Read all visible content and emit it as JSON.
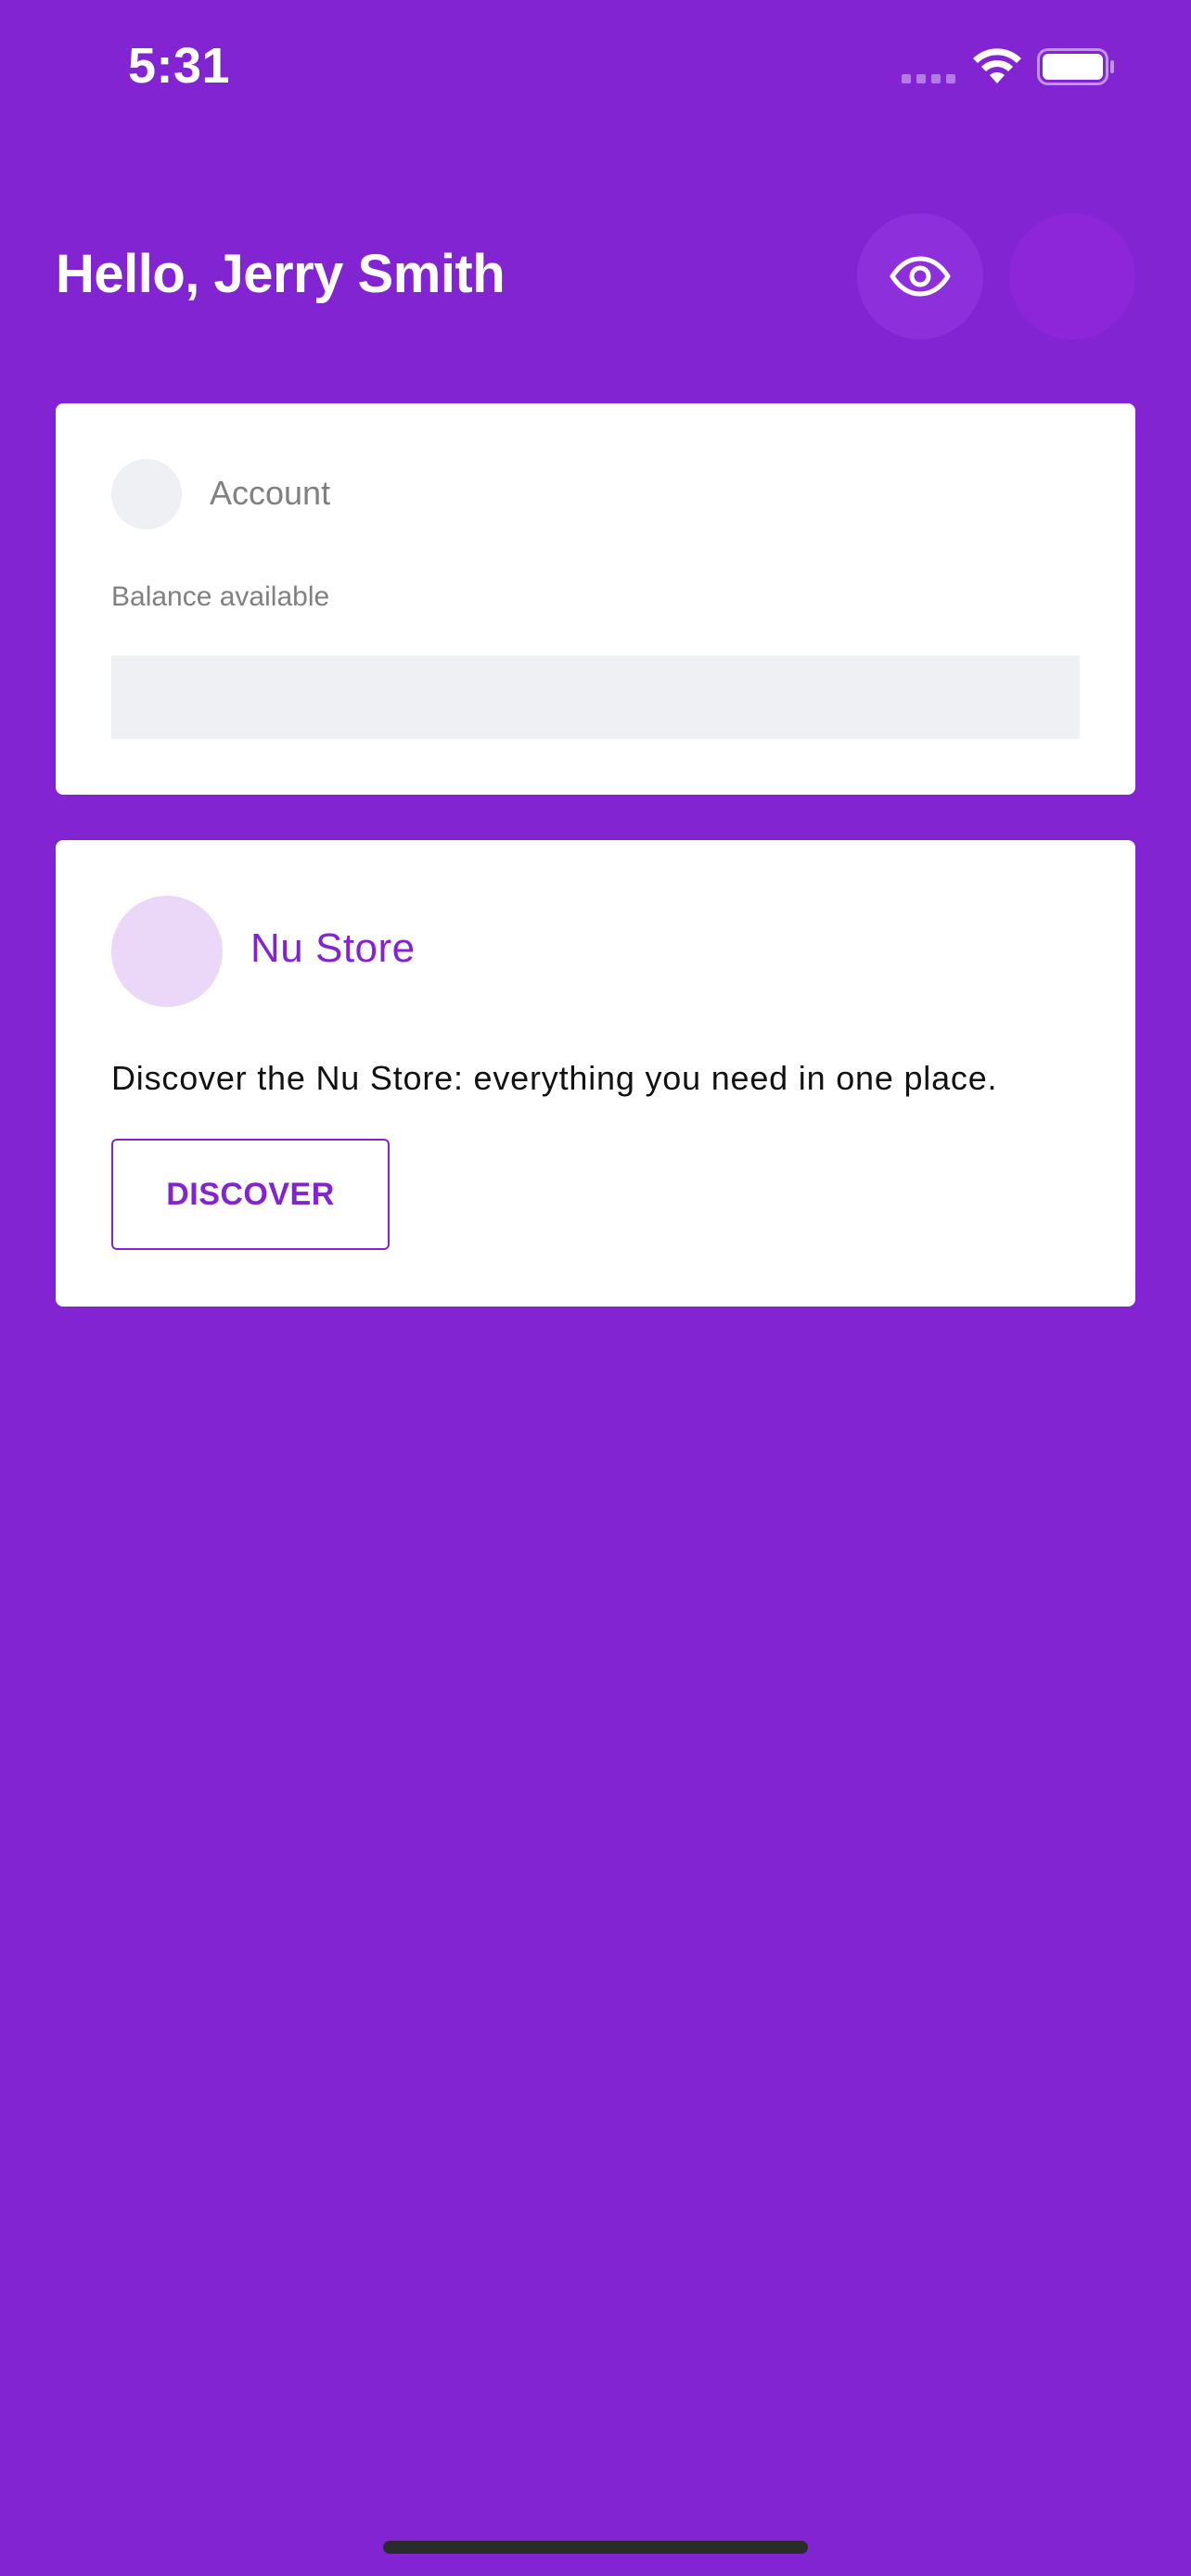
{
  "status_bar": {
    "time": "5:31",
    "icons": [
      "signal-dots-icon",
      "wifi-icon",
      "battery-icon"
    ]
  },
  "header": {
    "greeting": "Hello, Jerry Smith",
    "buttons": [
      {
        "name": "eye-button",
        "icon": "eye-icon"
      },
      {
        "name": "profile-button",
        "icon": "none"
      }
    ]
  },
  "account_card": {
    "title": "Account",
    "balance_label": "Balance available"
  },
  "store_card": {
    "title": "Nu Store",
    "description": "Discover the Nu Store: everything you need in one place.",
    "button_label": "DISCOVER"
  },
  "colors": {
    "background": "#8224D2",
    "accent": "#8224D2",
    "card": "#FFFFFF",
    "placeholder": "#EFF0F3",
    "store_avatar": "#EBD8F8"
  }
}
